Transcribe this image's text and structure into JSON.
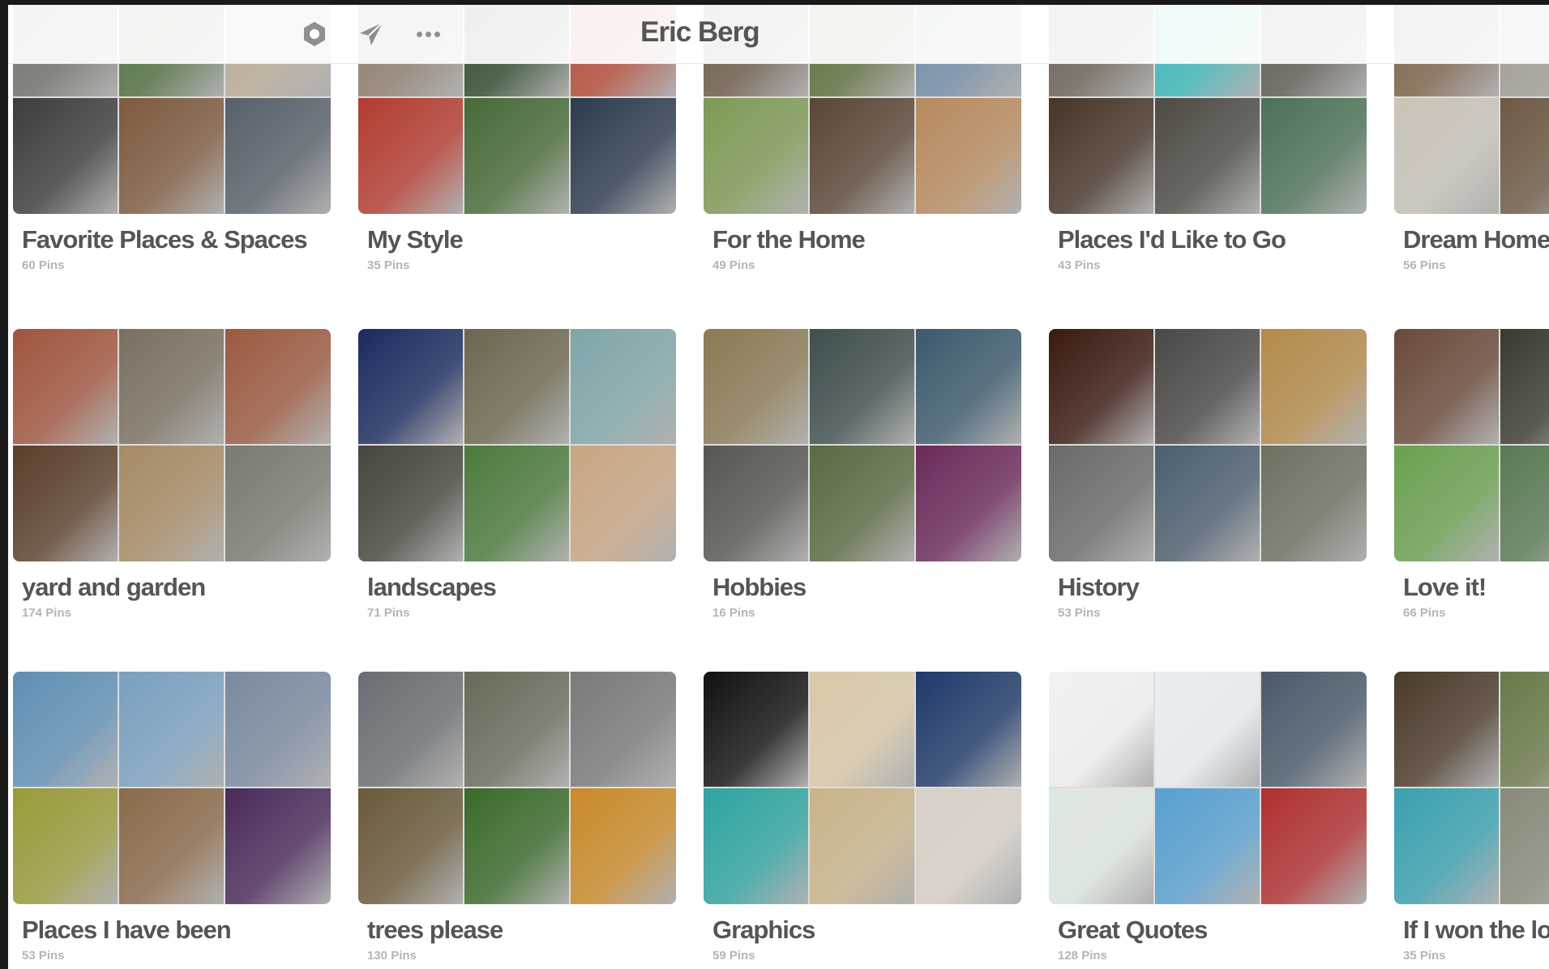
{
  "header": {
    "profile_name": "Eric Berg",
    "icons": [
      "settings-hexagon-icon",
      "send-icon",
      "more-icon"
    ]
  },
  "boards": [
    {
      "name": "Favorite Places & Spaces",
      "pins": "60 Pins",
      "colors": [
        "#6f6f6a",
        "#4f6e40",
        "#b9aa97",
        "#3d3d3d",
        "#7d5a3e",
        "#57606a"
      ]
    },
    {
      "name": "My Style",
      "pins": "35 Pins",
      "colors": [
        "#8c7b6a",
        "#2f4a2c",
        "#b24a37",
        "#b33c30",
        "#476a37",
        "#2c3b4e"
      ]
    },
    {
      "name": "For the Home",
      "pins": "49 Pins",
      "colors": [
        "#6b5a48",
        "#5b6d3a",
        "#6f8ba5",
        "#7e9a56",
        "#5a4636",
        "#b88a5e"
      ]
    },
    {
      "name": "Places I'd Like to Go",
      "pins": "43 Pins",
      "colors": [
        "#6a6055",
        "#3ab6b8",
        "#5e5a53",
        "#463528",
        "#4d4b44",
        "#4c7256"
      ]
    },
    {
      "name": "Dream Home",
      "pins": "56 Pins",
      "colors": [
        "#7a6147",
        "#a09a90",
        "#5a4433",
        "#c9c3b8",
        "#6d5a45",
        "#8d8a85"
      ]
    },
    {
      "name": "yard and garden",
      "pins": "174 Pins",
      "colors": [
        "#a0553e",
        "#7a7060",
        "#9b5a40",
        "#5a3e2a",
        "#a68b65",
        "#7a7a70"
      ]
    },
    {
      "name": "landscapes",
      "pins": "71 Pins",
      "colors": [
        "#1b2b5f",
        "#6d6750",
        "#7fa6a9",
        "#46463d",
        "#4c7a3d",
        "#c8a683"
      ]
    },
    {
      "name": "Hobbies",
      "pins": "16 Pins",
      "colors": [
        "#8b7a55",
        "#3e4f4e",
        "#3c5a6d",
        "#565652",
        "#5a6a42",
        "#6b2a5a"
      ]
    },
    {
      "name": "History",
      "pins": "53 Pins",
      "colors": [
        "#3a1a10",
        "#4a4846",
        "#b48a4a",
        "#6a6a68",
        "#4c5f6f",
        "#6e7060"
      ]
    },
    {
      "name": "Love it!",
      "pins": "66 Pins",
      "colors": [
        "#6a4a3a",
        "#3a3a30",
        "#4a6a3a",
        "#6aa050",
        "#5a7a55",
        "#7a8a8a"
      ]
    },
    {
      "name": "Places I have been",
      "pins": "53 Pins",
      "colors": [
        "#5f8fb5",
        "#7aa0c0",
        "#7a8aa0",
        "#9a9a3a",
        "#8a6a4a",
        "#4a2a5a"
      ]
    },
    {
      "name": "trees please",
      "pins": "130 Pins",
      "colors": [
        "#6a6e72",
        "#6a6a5a",
        "#7a7a7a",
        "#6a5a3a",
        "#3a6a2a",
        "#c98a2a"
      ]
    },
    {
      "name": "Graphics",
      "pins": "59 Pins",
      "colors": [
        "#111111",
        "#d9c9a8",
        "#1f3a6a",
        "#2fa4a0",
        "#c9b48a",
        "#d8d0c8"
      ]
    },
    {
      "name": "Great Quotes",
      "pins": "128 Pins",
      "colors": [
        "#f2f2f2",
        "#e9eef2",
        "#4a5a6a",
        "#dfe8e0",
        "#58a0d0",
        "#b03030"
      ]
    },
    {
      "name": "If I won the lottery",
      "pins": "35 Pins",
      "colors": [
        "#4a3a2a",
        "#6a7a4a",
        "#7a6a5a",
        "#3aa0b0",
        "#8a8a7a",
        "#5a6a5a"
      ]
    }
  ]
}
